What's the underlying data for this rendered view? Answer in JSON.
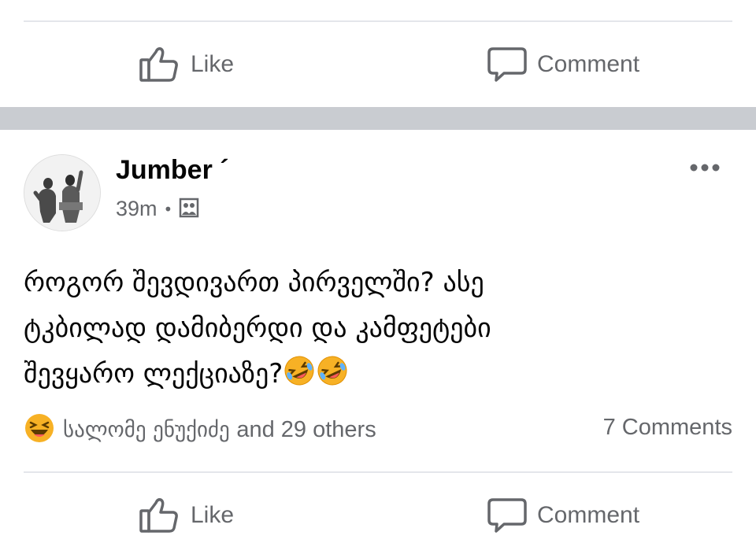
{
  "top_actions": {
    "like_label": "Like",
    "comment_label": "Comment"
  },
  "post": {
    "author_name": "Jumber ´",
    "time": "39m",
    "privacy_icon": "friends-icon",
    "text_lines": [
      "როგორ შევდივართ პირველში? ასე",
      "ტკბილად დამიბერდი და კამფეტები",
      "შევყარო ლექციაზე?"
    ],
    "trailing_emojis": [
      "rolling-on-floor-laughing",
      "rolling-on-floor-laughing"
    ],
    "reaction_icon": "haha-reaction-icon",
    "reactors_name": "სალომე ენუქიძე",
    "reactors_others": "and 29 others",
    "comments_count": "7 Comments"
  },
  "bottom_actions": {
    "like_label": "Like",
    "comment_label": "Comment"
  },
  "colors": {
    "secondary_text": "#65676b",
    "divider": "#e4e6eb",
    "band": "#c9ccd1",
    "emoji_yellow": "#f7b125"
  }
}
